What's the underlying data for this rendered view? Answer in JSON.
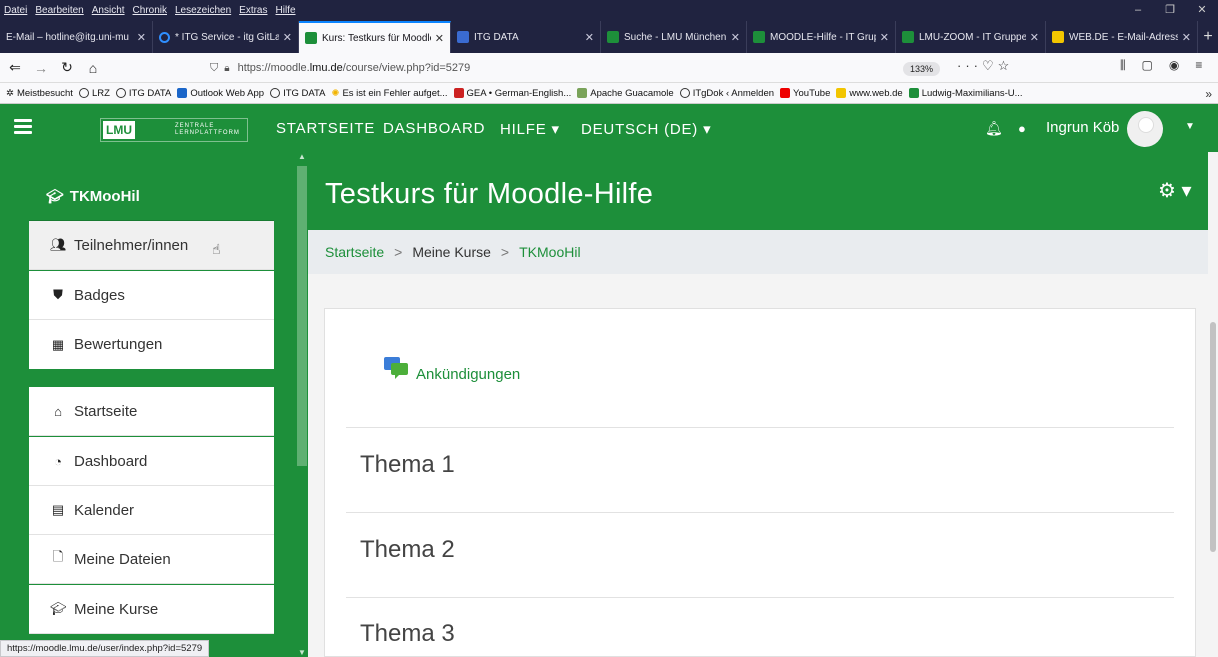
{
  "menubar": {
    "items": [
      "Datei",
      "Bearbeiten",
      "Ansicht",
      "Chronik",
      "Lesezeichen",
      "Extras",
      "Hilfe"
    ]
  },
  "tabs": [
    {
      "label": "E-Mail – hotline@itg.uni-mu",
      "active": false
    },
    {
      "label": "* ITG Service - itg GitLab",
      "active": false
    },
    {
      "label": "Kurs: Testkurs für Moodle",
      "active": true
    },
    {
      "label": "ITG DATA",
      "active": false
    },
    {
      "label": "Suche - LMU München",
      "active": false
    },
    {
      "label": "MOODLE-Hilfe - IT Grup",
      "active": false
    },
    {
      "label": "LMU-ZOOM - IT Gruppe",
      "active": false
    },
    {
      "label": "WEB.DE - E-Mail-Adress",
      "active": false
    }
  ],
  "address": {
    "prefix": "https://moodle.",
    "domain": "lmu.de",
    "suffix": "/course/view.php?id=5279",
    "zoom": "133%"
  },
  "bookmarks": [
    "Meistbesucht",
    "LRZ",
    "ITG DATA",
    "Outlook Web App",
    "ITG DATA",
    "Es ist ein Fehler aufget...",
    "GEA • German-English...",
    "Apache Guacamole",
    "ITgDok ‹ Anmelden",
    "YouTube",
    "www.web.de",
    "Ludwig-Maximilians-U..."
  ],
  "nav": {
    "logo_text": "LMU",
    "logo_sub": "ZENTRALE LERNPLATTFORM",
    "startseite": "STARTSEITE",
    "dashboard": "DASHBOARD",
    "hilfe": "HILFE ▾",
    "language": "DEUTSCH (DE) ▾",
    "user": "Ingrun Köb"
  },
  "sidebar": {
    "course_short": "TKMooHil",
    "course_items": [
      "Teilnehmer/innen",
      "Badges",
      "Bewertungen"
    ],
    "site_items": [
      "Startseite",
      "Dashboard",
      "Kalender",
      "Meine Dateien",
      "Meine Kurse"
    ]
  },
  "course": {
    "title": "Testkurs für Moodle-Hilfe",
    "breadcrumb": [
      "Startseite",
      "Meine Kurse",
      "TKMooHil"
    ],
    "announcements": "Ankündigungen",
    "topics": [
      "Thema 1",
      "Thema 2",
      "Thema 3"
    ]
  },
  "status_url": "https://moodle.lmu.de/user/index.php?id=5279",
  "colors": {
    "moodle_green": "#1d8f3a",
    "tab_bar": "#202340"
  }
}
